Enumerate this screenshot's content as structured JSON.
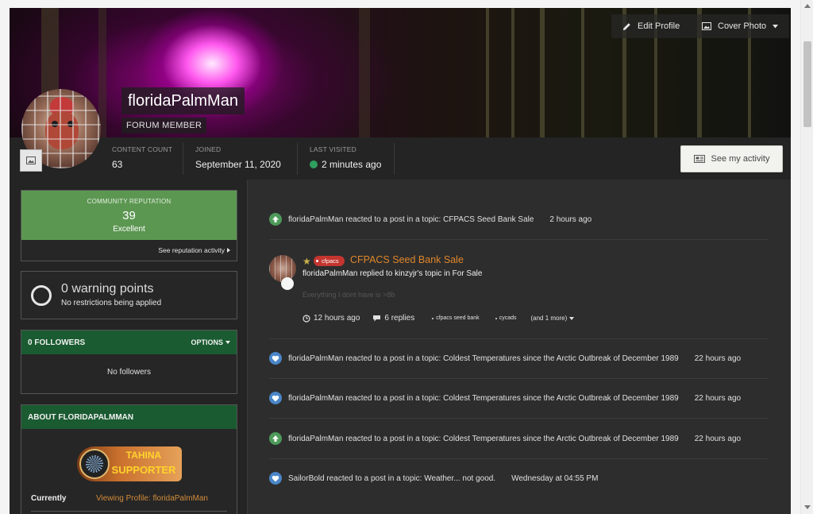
{
  "cover": {
    "edit_profile": "Edit Profile",
    "cover_photo": "Cover Photo"
  },
  "profile": {
    "name": "floridaPalmMan",
    "group": "FORUM MEMBER"
  },
  "stats": {
    "content_count_label": "CONTENT COUNT",
    "content_count": "63",
    "joined_label": "JOINED",
    "joined": "September 11, 2020",
    "last_visited_label": "LAST VISITED",
    "last_visited": "2 minutes ago"
  },
  "see_activity": "See my activity",
  "reputation": {
    "label": "COMMUNITY REPUTATION",
    "value": "39",
    "level": "Excellent",
    "link": "See reputation activity"
  },
  "warnings": {
    "points": "0 warning points",
    "note": "No restrictions being applied"
  },
  "followers": {
    "title": "0 FOLLOWERS",
    "options": "OPTIONS",
    "empty": "No followers"
  },
  "about": {
    "title": "ABOUT FLORIDAPALMMAN",
    "badge_line1": "TAHINA",
    "badge_line2": "SUPPORTER",
    "currently_label": "Currently",
    "currently_value": "Viewing Profile: floridaPalmMan"
  },
  "feed": [
    {
      "text": "floridaPalmMan reacted to a post in a topic: CFPACS Seed Bank Sale",
      "time": "2 hours ago",
      "icon": "upvote-icon"
    },
    {
      "text": "floridaPalmMan reacted to a post in a topic: Coldest Temperatures since the Arctic Outbreak of December 1989",
      "time": "22 hours ago",
      "icon": "heart-icon"
    },
    {
      "text": "floridaPalmMan reacted to a post in a topic: Coldest Temperatures since the Arctic Outbreak of December 1989",
      "time": "22 hours ago",
      "icon": "heart-icon"
    },
    {
      "text": "floridaPalmMan reacted to a post in a topic: Coldest Temperatures since the Arctic Outbreak of December 1989",
      "time": "22 hours ago",
      "icon": "upvote-icon"
    },
    {
      "text": "SailorBold reacted to a post in a topic: Weather... not good.",
      "time": "Wednesday at 04:55 PM",
      "icon": "heart-icon"
    }
  ],
  "post": {
    "prefix": "cfpacs",
    "title": "CFPACS Seed Bank Sale",
    "subtitle": "floridaPalmMan replied to kinzyjr's topic in For Sale",
    "excerpt": "Everything I dont have is >8b",
    "time": "12 hours ago",
    "replies": "6 replies",
    "tags": [
      "cfpacs seed bank",
      "cycads"
    ],
    "more": "(and 1 more)"
  },
  "colors": {
    "reputation_green": "#5c9752",
    "section_green": "#1a5b31",
    "link_orange": "#e0862a",
    "online_green": "#2f9e5f",
    "prefix_red": "#c4352f"
  }
}
